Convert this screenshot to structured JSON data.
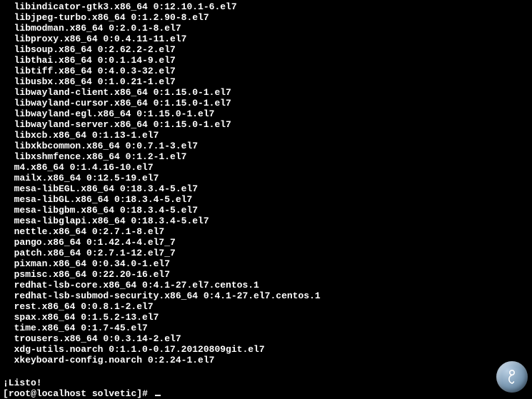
{
  "packages": [
    "libindicator-gtk3.x86_64 0:12.10.1-6.el7",
    "libjpeg-turbo.x86_64 0:1.2.90-8.el7",
    "libmodman.x86_64 0:2.0.1-8.el7",
    "libproxy.x86_64 0:0.4.11-11.el7",
    "libsoup.x86_64 0:2.62.2-2.el7",
    "libthai.x86_64 0:0.1.14-9.el7",
    "libtiff.x86_64 0:4.0.3-32.el7",
    "libusbx.x86_64 0:1.0.21-1.el7",
    "libwayland-client.x86_64 0:1.15.0-1.el7",
    "libwayland-cursor.x86_64 0:1.15.0-1.el7",
    "libwayland-egl.x86_64 0:1.15.0-1.el7",
    "libwayland-server.x86_64 0:1.15.0-1.el7",
    "libxcb.x86_64 0:1.13-1.el7",
    "libxkbcommon.x86_64 0:0.7.1-3.el7",
    "libxshmfence.x86_64 0:1.2-1.el7",
    "m4.x86_64 0:1.4.16-10.el7",
    "mailx.x86_64 0:12.5-19.el7",
    "mesa-libEGL.x86_64 0:18.3.4-5.el7",
    "mesa-libGL.x86_64 0:18.3.4-5.el7",
    "mesa-libgbm.x86_64 0:18.3.4-5.el7",
    "mesa-libglapi.x86_64 0:18.3.4-5.el7",
    "nettle.x86_64 0:2.7.1-8.el7",
    "pango.x86_64 0:1.42.4-4.el7_7",
    "patch.x86_64 0:2.7.1-12.el7_7",
    "pixman.x86_64 0:0.34.0-1.el7",
    "psmisc.x86_64 0:22.20-16.el7",
    "redhat-lsb-core.x86_64 0:4.1-27.el7.centos.1",
    "redhat-lsb-submod-security.x86_64 0:4.1-27.el7.centos.1",
    "rest.x86_64 0:0.8.1-2.el7",
    "spax.x86_64 0:1.5.2-13.el7",
    "time.x86_64 0:1.7-45.el7",
    "trousers.x86_64 0:0.3.14-2.el7",
    "xdg-utils.noarch 0:1.1.0-0.17.20120809git.el7",
    "xkeyboard-config.noarch 0:2.24-1.el7"
  ],
  "status": "¡Listo!",
  "prompt": {
    "user_host": "root@localhost",
    "cwd": "solvetic",
    "symbol": "#"
  },
  "watermark": "solvetic-logo"
}
